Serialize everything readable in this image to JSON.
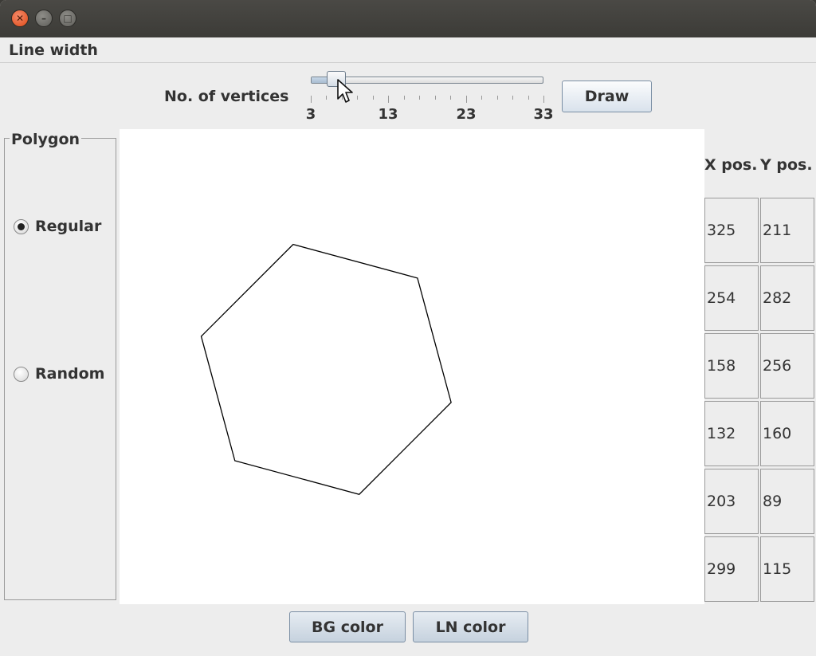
{
  "menubar": {
    "line_width_label": "Line width"
  },
  "controls": {
    "vertices_label": "No. of vertices",
    "slider": {
      "min": 3,
      "max": 33,
      "value": 6,
      "ticks_labeled": [
        "3",
        "13",
        "23",
        "33"
      ]
    },
    "draw_label": "Draw"
  },
  "polygon_group": {
    "title": "Polygon",
    "options": [
      {
        "label": "Regular",
        "selected": true
      },
      {
        "label": "Random",
        "selected": false
      }
    ]
  },
  "table": {
    "headers": {
      "x": "X pos.",
      "y": "Y pos."
    },
    "rows": [
      {
        "x": "325",
        "y": "211"
      },
      {
        "x": "254",
        "y": "282"
      },
      {
        "x": "158",
        "y": "256"
      },
      {
        "x": "132",
        "y": "160"
      },
      {
        "x": "203",
        "y": "89"
      },
      {
        "x": "299",
        "y": "115"
      }
    ]
  },
  "bottom": {
    "bg_color_label": "BG color",
    "ln_color_label": "LN color"
  },
  "colors": {
    "line": "#000000",
    "background": "#ffffff"
  }
}
